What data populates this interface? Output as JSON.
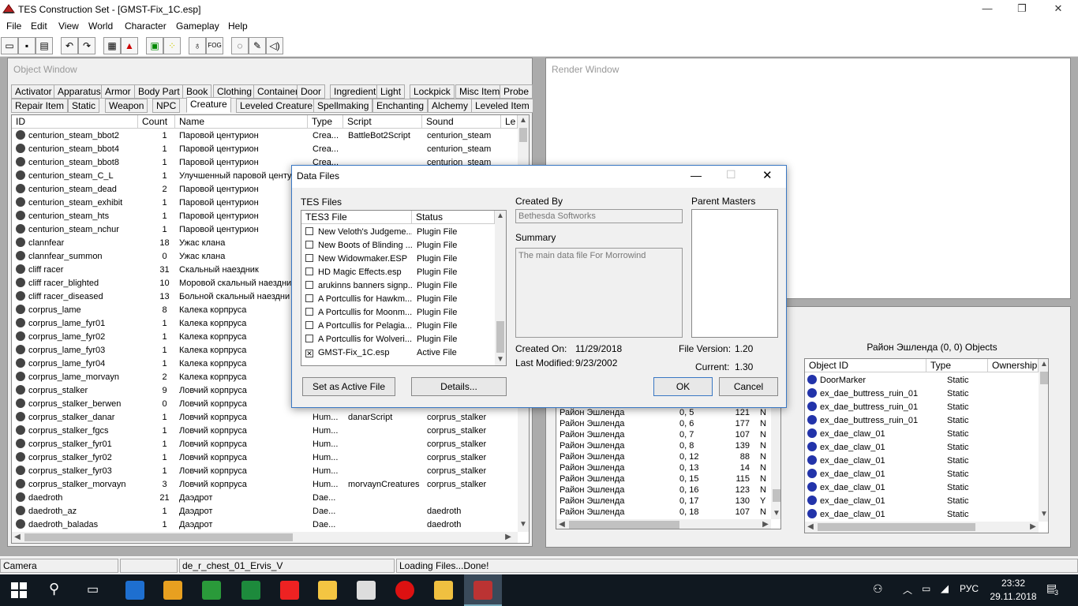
{
  "app": {
    "title": "TES Construction Set - [GMST-Fix_1C.esp]",
    "win_min": "—",
    "win_max": "❐",
    "win_close": "✕"
  },
  "menu": [
    "File",
    "Edit",
    "View",
    "World",
    "Character",
    "Gameplay",
    "Help"
  ],
  "toolbar": [
    "open-icon",
    "save-icon",
    "properties-icon",
    "undo-icon",
    "redo-icon",
    "grid-icon",
    "terrain-icon",
    "landscape-icon",
    "path-grid-icon",
    "light-icon",
    "fog-icon",
    "dialogue-icon",
    "script-icon",
    "sound-icon"
  ],
  "object_window": {
    "title": "Object Window",
    "tabs_row1": [
      "Activator",
      "Apparatus",
      "Armor",
      "Body Part",
      "Book",
      "Clothing",
      "Container",
      "Door",
      "Ingredient",
      "Light",
      "Lockpick",
      "Misc Item",
      "Probe"
    ],
    "tabs_row2": [
      "Repair Item",
      "Static",
      "Weapon",
      "NPC",
      "Creature",
      "Leveled Creature",
      "Spellmaking",
      "Enchanting",
      "Alchemy",
      "Leveled Item"
    ],
    "columns": [
      "ID",
      "Count",
      "Name",
      "Type",
      "Script",
      "Sound",
      "Le"
    ],
    "rows": [
      [
        "centurion_steam_bbot2",
        "1",
        "Паровой центурион",
        "Crea...",
        "BattleBot2Script",
        "centurion_steam"
      ],
      [
        "centurion_steam_bbot4",
        "1",
        "Паровой центурион",
        "Crea...",
        "",
        "centurion_steam"
      ],
      [
        "centurion_steam_bbot8",
        "1",
        "Паровой центурион",
        "Crea...",
        "",
        "centurion_steam"
      ],
      [
        "centurion_steam_C_L",
        "1",
        "Улучшенный паровой центур",
        "",
        "",
        ""
      ],
      [
        "centurion_steam_dead",
        "2",
        "Паровой центурион",
        "",
        "",
        ""
      ],
      [
        "centurion_steam_exhibit",
        "1",
        "Паровой центурион",
        "",
        "",
        ""
      ],
      [
        "centurion_steam_hts",
        "1",
        "Паровой центурион",
        "",
        "",
        ""
      ],
      [
        "centurion_steam_nchur",
        "1",
        "Паровой центурион",
        "",
        "",
        ""
      ],
      [
        "clannfear",
        "18",
        "Ужас клана",
        "",
        "",
        ""
      ],
      [
        "clannfear_summon",
        "0",
        "Ужас клана",
        "",
        "",
        ""
      ],
      [
        "cliff racer",
        "31",
        "Скальный наездник",
        "",
        "",
        ""
      ],
      [
        "cliff racer_blighted",
        "10",
        "Моровой скальный наездни",
        "",
        "",
        ""
      ],
      [
        "cliff racer_diseased",
        "13",
        "Больной скальный наездни",
        "",
        "",
        ""
      ],
      [
        "corprus_lame",
        "8",
        "Калека корпруса",
        "",
        "",
        ""
      ],
      [
        "corprus_lame_fyr01",
        "1",
        "Калека корпруса",
        "",
        "",
        ""
      ],
      [
        "corprus_lame_fyr02",
        "1",
        "Калека корпруса",
        "",
        "",
        ""
      ],
      [
        "corprus_lame_fyr03",
        "1",
        "Калека корпруса",
        "",
        "",
        ""
      ],
      [
        "corprus_lame_fyr04",
        "1",
        "Калека корпруса",
        "",
        "",
        ""
      ],
      [
        "corprus_lame_morvayn",
        "2",
        "Калека корпруса",
        "",
        "",
        ""
      ],
      [
        "corprus_stalker",
        "9",
        "Ловчий корпруса",
        "",
        "",
        ""
      ],
      [
        "corprus_stalker_berwen",
        "0",
        "Ловчий корпруса",
        "",
        "",
        ""
      ],
      [
        "corprus_stalker_danar",
        "1",
        "Ловчий корпруса",
        "Hum...",
        "danarScript",
        "corprus_stalker"
      ],
      [
        "corprus_stalker_fgcs",
        "1",
        "Ловчий корпруса",
        "Hum...",
        "",
        "corprus_stalker"
      ],
      [
        "corprus_stalker_fyr01",
        "1",
        "Ловчий корпруса",
        "Hum...",
        "",
        "corprus_stalker"
      ],
      [
        "corprus_stalker_fyr02",
        "1",
        "Ловчий корпруса",
        "Hum...",
        "",
        "corprus_stalker"
      ],
      [
        "corprus_stalker_fyr03",
        "1",
        "Ловчий корпруса",
        "Hum...",
        "",
        "corprus_stalker"
      ],
      [
        "corprus_stalker_morvayn",
        "3",
        "Ловчий корпруса",
        "Hum...",
        "morvaynCreatures",
        "corprus_stalker"
      ],
      [
        "daedroth",
        "21",
        "Даэдрот",
        "Dae...",
        "",
        ""
      ],
      [
        "daedroth_az",
        "1",
        "Даэдрот",
        "Dae...",
        "",
        "daedroth"
      ],
      [
        "daedroth_baladas",
        "1",
        "Даэдрот",
        "Dae...",
        "",
        "daedroth"
      ]
    ]
  },
  "render_window": {
    "title": "Render Window"
  },
  "cell_view": {
    "objects_title": "Район Эшленда (0, 0) Objects",
    "cell_rows": [
      [
        "Район Эшленда",
        "0, 5",
        "121",
        "N"
      ],
      [
        "Район Эшленда",
        "0, 6",
        "177",
        "N"
      ],
      [
        "Район Эшленда",
        "0, 7",
        "107",
        "N"
      ],
      [
        "Район Эшленда",
        "0, 8",
        "139",
        "N"
      ],
      [
        "Район Эшленда",
        "0, 12",
        "88",
        "N"
      ],
      [
        "Район Эшленда",
        "0, 13",
        "14",
        "N"
      ],
      [
        "Район Эшленда",
        "0, 15",
        "115",
        "N"
      ],
      [
        "Район Эшленда",
        "0, 16",
        "123",
        "N"
      ],
      [
        "Район Эшленда",
        "0, 17",
        "130",
        "Y"
      ],
      [
        "Район Эшленда",
        "0, 18",
        "107",
        "N"
      ]
    ],
    "obj_columns": [
      "Object ID",
      "Type",
      "Ownership"
    ],
    "obj_rows": [
      [
        "DoorMarker",
        "Static"
      ],
      [
        "ex_dae_buttress_ruin_01",
        "Static"
      ],
      [
        "ex_dae_buttress_ruin_01",
        "Static"
      ],
      [
        "ex_dae_buttress_ruin_01",
        "Static"
      ],
      [
        "ex_dae_claw_01",
        "Static"
      ],
      [
        "ex_dae_claw_01",
        "Static"
      ],
      [
        "ex_dae_claw_01",
        "Static"
      ],
      [
        "ex_dae_claw_01",
        "Static"
      ],
      [
        "ex_dae_claw_01",
        "Static"
      ],
      [
        "ex_dae_claw_01",
        "Static"
      ],
      [
        "ex_dae_claw_01",
        "Static"
      ]
    ]
  },
  "dialog": {
    "title": "Data Files",
    "tes_files_label": "TES Files",
    "col_file": "TES3 File",
    "col_status": "Status",
    "files": [
      {
        "name": "New Veloth's Judgeme...",
        "status": "Plugin File",
        "checked": ""
      },
      {
        "name": "New Boots of Blinding ...",
        "status": "Plugin File",
        "checked": ""
      },
      {
        "name": "New Widowmaker.ESP",
        "status": "Plugin File",
        "checked": ""
      },
      {
        "name": "HD Magic Effects.esp",
        "status": "Plugin File",
        "checked": ""
      },
      {
        "name": "arukinns banners signp...",
        "status": "Plugin File",
        "checked": ""
      },
      {
        "name": "A Portcullis for Hawkm...",
        "status": "Plugin File",
        "checked": ""
      },
      {
        "name": "A Portcullis for Moonm...",
        "status": "Plugin File",
        "checked": ""
      },
      {
        "name": "A Portcullis for Pelagia...",
        "status": "Plugin File",
        "checked": ""
      },
      {
        "name": "A Portcullis for Wolveri...",
        "status": "Plugin File",
        "checked": ""
      },
      {
        "name": "GMST-Fix_1C.esp",
        "status": "Active File",
        "checked": "✕"
      }
    ],
    "created_by_label": "Created By",
    "created_by": "Bethesda Softworks",
    "summary_label": "Summary",
    "summary": "The main data file For Morrowind",
    "parent_masters_label": "Parent Masters",
    "created_on_label": "Created On:",
    "created_on": "11/29/2018",
    "last_modified_label": "Last Modified:",
    "last_modified": "9/23/2002",
    "file_version_label": "File Version:",
    "file_version": "1.20",
    "current_label": "Current:",
    "current": "1.30",
    "set_active": "Set as Active File",
    "details": "Details...",
    "ok": "OK",
    "cancel": "Cancel"
  },
  "status": {
    "p1": "Camera",
    "p2": "",
    "p3": "de_r_chest_01_Ervis_V",
    "p4": "Loading Files...Done!"
  },
  "taskbar": {
    "lang": "РУС",
    "time": "23:32",
    "date": "29.11.2018",
    "notif": "3"
  }
}
